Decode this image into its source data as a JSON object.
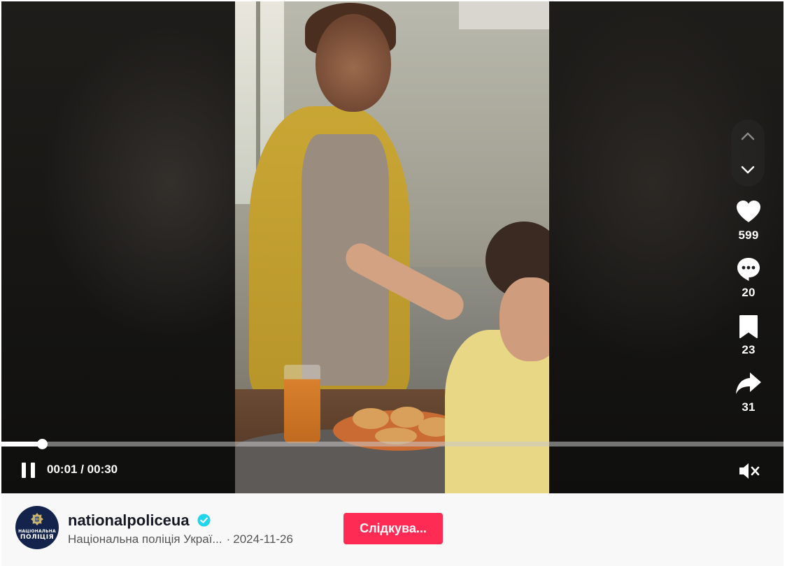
{
  "player": {
    "elapsed": "00:01",
    "duration": "00:30",
    "progress_fraction": 0.052,
    "muted": true
  },
  "actions": {
    "likes": "599",
    "comments": "20",
    "saves": "23",
    "shares": "31"
  },
  "author": {
    "username": "nationalpoliceua",
    "display_name": "Національна поліція Украї...",
    "date": "2024-11-26",
    "follow_label": "Слідкува...",
    "avatar_text_top": "НАЦІОНАЛЬНА",
    "avatar_text_bottom": "ПОЛІЦІЯ"
  },
  "colors": {
    "accent": "#fe2c55",
    "verified": "#20d5ec",
    "avatar_bg": "#13234b"
  },
  "icons": {
    "pause": "pause-icon",
    "mute": "mute-icon",
    "like": "heart-icon",
    "comment": "comment-icon",
    "save": "bookmark-icon",
    "share": "share-icon",
    "prev": "chevron-up-icon",
    "next": "chevron-down-icon",
    "verified": "verified-badge-icon"
  }
}
